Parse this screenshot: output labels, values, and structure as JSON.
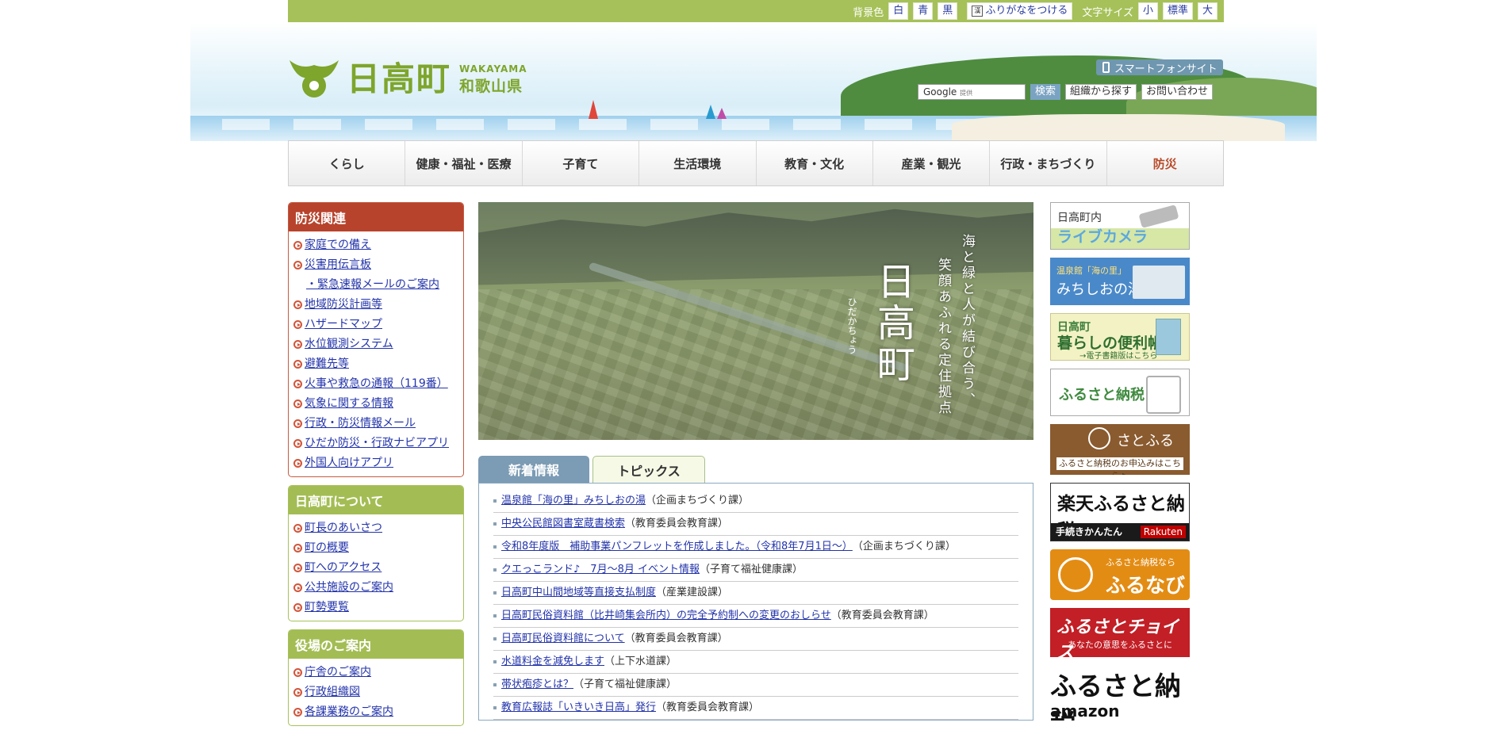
{
  "topbar": {
    "bg_label": "背景色",
    "bg_white": "白",
    "bg_blue": "青",
    "bg_black": "黒",
    "furigana_kanji": "漢",
    "furigana_label": "ふりがなをつける",
    "font_size_label": "文字サイズ",
    "font_small": "小",
    "font_standard": "標準",
    "font_large": "大"
  },
  "logo": {
    "name": "日高町",
    "sub_en": "WAKAYAMA",
    "sub_jp": "和歌山県",
    "brand_color": "#7ea52c"
  },
  "header": {
    "smartphone_site": "スマートフォンサイト",
    "search_placeholder": "Google",
    "search_provided": "提供",
    "search_button": "検索",
    "org_search_button": "組織から探す",
    "contact_button": "お問い合わせ"
  },
  "global_nav": [
    {
      "label": "くらし"
    },
    {
      "label": "健康・福祉・医療"
    },
    {
      "label": "子育て"
    },
    {
      "label": "生活環境"
    },
    {
      "label": "教育・文化"
    },
    {
      "label": "産業・観光"
    },
    {
      "label": "行政・まちづくり"
    },
    {
      "label": "防災"
    }
  ],
  "sidebar": {
    "bousai": {
      "title": "防災関連",
      "items": [
        "家庭での備え",
        "災害用伝言板",
        "・緊急速報メールのご案内",
        "地域防災計画等",
        "ハザードマップ",
        "水位観測システム",
        "避難先等",
        "火事や救急の通報（119番）",
        "気象に関する情報",
        "行政・防災情報メール",
        "ひだか防災・行政ナビアプリ",
        "外国人向けアプリ"
      ]
    },
    "about": {
      "title": "日高町について",
      "items": [
        "町長のあいさつ",
        "町の概要",
        "町へのアクセス",
        "公共施設のご案内",
        "町勢要覧"
      ]
    },
    "office": {
      "title": "役場のご案内",
      "items": [
        "庁舎のご案内",
        "行政組織図",
        "各課業務のご案内"
      ]
    }
  },
  "hero": {
    "title": "日高町",
    "ruby": "ひだかちょう",
    "copy1": "海と緑と人が結び合う、",
    "copy2": "笑顔あふれる定住拠点"
  },
  "tabs": {
    "news": "新着情報",
    "topics": "トピックス"
  },
  "news": [
    {
      "title": "温泉館「海の里」みちしおの湯",
      "dept": "（企画まちづくり課）"
    },
    {
      "title": "中央公民館図書室蔵書検索",
      "dept": "（教育委員会教育課）"
    },
    {
      "title": "令和8年度版　補助事業パンフレットを作成しました。（令和8年7月1日～）",
      "dept": "（企画まちづくり課）"
    },
    {
      "title": "クエっこランド♪　7月～8月 イベント情報",
      "dept": "（子育て福祉健康課）"
    },
    {
      "title": "日高町中山間地域等直接支払制度",
      "dept": "（産業建設課）"
    },
    {
      "title": "日高町民俗資料館（比井崎集会所内）の完全予約制への変更のおしらせ",
      "dept": "（教育委員会教育課）"
    },
    {
      "title": "日高町民俗資料館について",
      "dept": "（教育委員会教育課）"
    },
    {
      "title": "水道料金を減免します",
      "dept": "（上下水道課）"
    },
    {
      "title": "帯状疱疹とは？",
      "dept": "（子育て福祉健康課）"
    },
    {
      "title": "教育広報誌「いきいき日高」発行",
      "dept": "（教育委員会教育課）"
    }
  ],
  "banners": {
    "livecam_line1": "日高町内",
    "livecam_line2": "ライブカメラ",
    "michishio_line1": "温泉館「海の里」",
    "michishio_line2": "みちしおの湯",
    "benri_line1": "日高町",
    "benri_line2": "暮らしの便利帳",
    "benri_line3": "→電子書籍版はこちら",
    "furusato_nozei": "ふるさと納税",
    "satofull_name": "さとふる",
    "satofull_sub": "ふるさと納税のお申込みはこちら ▶",
    "rakuten_title": "楽天ふるさと納税",
    "rakuten_sub": "手続きかんたん",
    "rakuten_logo": "Rakuten",
    "furunavi_line1": "ふるさと納税なら",
    "furunavi_line2": "ふるなび",
    "choice_line1": "ふるさとチョイス",
    "choice_line2": "あなたの意思をふるさとに",
    "amazon_line1": "ふるさと納税",
    "amazon_line2": "amazon"
  }
}
